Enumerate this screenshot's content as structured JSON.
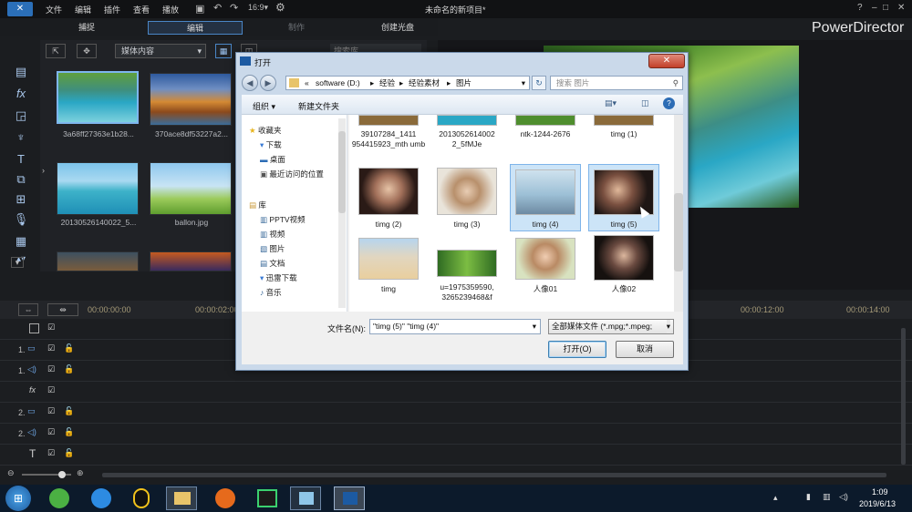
{
  "app": {
    "brand": "PowerDirector",
    "project_title": "未命名的新项目*",
    "menu": [
      "文件",
      "编辑",
      "插件",
      "查看",
      "播放"
    ],
    "tabs": [
      "捕捉",
      "编辑",
      "制作",
      "创建光盘"
    ],
    "window_controls": [
      "?",
      "–",
      "□",
      "✕"
    ]
  },
  "library": {
    "dropdown": "媒体内容",
    "search_placeholder": "搜索库",
    "items": [
      {
        "label": "3a68ff27363e1b28..."
      },
      {
        "label": "370ace8df53227a2..."
      },
      {
        "label": "20130526140022_5..."
      },
      {
        "label": "ballon.jpg"
      }
    ]
  },
  "timeline": {
    "timecodes": [
      "00:00:00:00",
      "00:00:02:00",
      "00:00:12:00",
      "00:00:14:00"
    ],
    "tracks": [
      "",
      "1.",
      "1.",
      "",
      "2.",
      "2.",
      ""
    ]
  },
  "dialog": {
    "title": "打开",
    "path": [
      "«",
      "software (D:)",
      "经验",
      "经验素材",
      "图片"
    ],
    "search_placeholder": "搜索 图片",
    "organize": "组织 ▾",
    "new_folder": "新建文件夹",
    "nav": [
      {
        "label": "收藏夹",
        "icon": "star-icon"
      },
      {
        "label": "下载",
        "icon": "download-folder-icon"
      },
      {
        "label": "桌面",
        "icon": "desktop-icon"
      },
      {
        "label": "最近访问的位置",
        "icon": "recent-icon"
      },
      {
        "label": "库",
        "icon": "library-icon"
      },
      {
        "label": "PPTV视频",
        "icon": "video-folder-icon"
      },
      {
        "label": "视频",
        "icon": "video-folder-icon"
      },
      {
        "label": "图片",
        "icon": "picture-folder-icon"
      },
      {
        "label": "文档",
        "icon": "document-folder-icon"
      },
      {
        "label": "迅雷下载",
        "icon": "download-folder-icon"
      },
      {
        "label": "音乐",
        "icon": "music-folder-icon"
      }
    ],
    "files": [
      {
        "label": "39107284_1411 954415923_mth umb"
      },
      {
        "label": "2013052614002 2_5fMJe"
      },
      {
        "label": "ntk-1244-2676"
      },
      {
        "label": "timg (1)"
      },
      {
        "label": "timg (2)"
      },
      {
        "label": "timg (3)"
      },
      {
        "label": "timg (4)"
      },
      {
        "label": "timg (5)"
      },
      {
        "label": "timg"
      },
      {
        "label": "u=1975359590, 3265239468&f"
      },
      {
        "label": "人像01"
      },
      {
        "label": "人像02"
      }
    ],
    "filename_label": "文件名(N):",
    "filename_value": "\"timg (5)\" \"timg (4)\"",
    "filetype_value": "全部媒体文件 (*.mpg;*.mpeg;",
    "open_button": "打开(O)",
    "cancel_button": "取消"
  },
  "taskbar": {
    "time": "1:09",
    "date": "2019/6/13"
  }
}
